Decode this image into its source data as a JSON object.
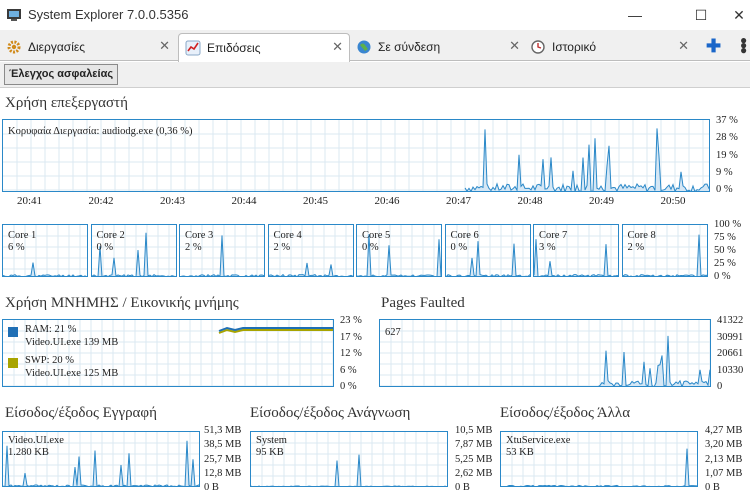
{
  "window": {
    "title": "System Explorer 7.0.0.5356",
    "minimize": "—",
    "maximize": "☐",
    "close": "✕"
  },
  "tabs": [
    {
      "label": "Διεργασίες",
      "icon": "gear-icon",
      "close": "✕",
      "active": false
    },
    {
      "label": "Επιδόσεις",
      "icon": "performance-icon",
      "close": "✕",
      "active": true
    },
    {
      "label": "Σε σύνδεση",
      "icon": "globe-icon",
      "close": "✕",
      "active": false
    },
    {
      "label": "Ιστορικό",
      "icon": "clock-icon",
      "close": "✕",
      "active": false
    }
  ],
  "tab_add": "✚",
  "toolbar": {
    "security_check": "Έλεγχος ασφαλείας"
  },
  "cpu": {
    "title": "Χρήση επεξεργαστή",
    "peak": "Κορυφαία Διεργασία: audiodg.exe (0,36 %)",
    "y_ticks": [
      "37 %",
      "28 %",
      "19 %",
      "9 %",
      "0 %"
    ],
    "x_ticks": [
      "20:41",
      "20:42",
      "20:43",
      "20:44",
      "20:45",
      "20:46",
      "20:47",
      "20:48",
      "20:49",
      "20:50"
    ]
  },
  "cores": {
    "y_ticks": [
      "100 %",
      "75 %",
      "50 %",
      "25 %",
      "0 %"
    ],
    "items": [
      {
        "name": "Core 1",
        "value": "6 %"
      },
      {
        "name": "Core 2",
        "value": "0 %"
      },
      {
        "name": "Core 3",
        "value": "2 %"
      },
      {
        "name": "Core 4",
        "value": "2 %"
      },
      {
        "name": "Core 5",
        "value": "0 %"
      },
      {
        "name": "Core 6",
        "value": "0 %"
      },
      {
        "name": "Core 7",
        "value": "3 %"
      },
      {
        "name": "Core 8",
        "value": "2 %"
      }
    ]
  },
  "memory": {
    "title": "Χρήση ΜΝΗΜΗΣ / Εικονικής μνήμης",
    "ram": {
      "label": "RAM: 21 %",
      "process": "Video.UI.exe 139 MB",
      "color": "#1f6fb5"
    },
    "swp": {
      "label": "SWP: 20 %",
      "process": "Video.UI.exe 125 MB",
      "color": "#a8a400"
    },
    "y_ticks": [
      "23 %",
      "17 %",
      "12 %",
      "6 %",
      "0 %"
    ]
  },
  "pages": {
    "title": "Pages Faulted",
    "value": "627",
    "y_ticks": [
      "41322",
      "30991",
      "20661",
      "10330",
      "0"
    ]
  },
  "io_write": {
    "title": "Είσοδος/έξοδος Εγγραφή",
    "process": "Video.UI.exe",
    "value": "1.280 KB",
    "y_ticks": [
      "51,3 MB",
      "38,5 MB",
      "25,7 MB",
      "12,8 MB",
      "0 B"
    ]
  },
  "io_read": {
    "title": "Είσοδος/έξοδος Ανάγνωση",
    "process": "System",
    "value": "95 KB",
    "y_ticks": [
      "10,5 MB",
      "7,87 MB",
      "5,25 MB",
      "2,62 MB",
      "0 B"
    ]
  },
  "io_other": {
    "title": "Είσοδος/έξοδος Άλλα",
    "process": "XtuService.exe",
    "value": "53 KB",
    "y_ticks": [
      "4,27 MB",
      "3,20 MB",
      "2,13 MB",
      "1,07 MB",
      "0 B"
    ]
  },
  "colors": {
    "graph_line": "#2a88c8",
    "grid": "#dbe8f2",
    "fill": "#d5e7f5"
  }
}
